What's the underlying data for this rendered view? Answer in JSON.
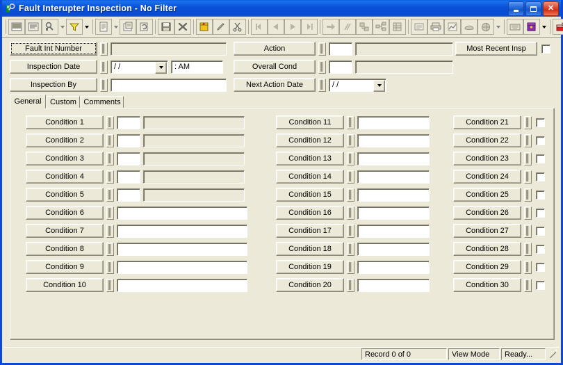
{
  "window": {
    "title": "Fault Interupter Inspection - No Filter",
    "app_icon": "magnifier-person-icon",
    "minimize_label": "Minimize",
    "maximize_label": "Maximize",
    "close_label": "Close"
  },
  "toolbar": {
    "buttons": [
      {
        "name": "select-records-icon",
        "glyph": "▦",
        "dropdown": false,
        "disabled": true
      },
      {
        "name": "query-builder-icon",
        "glyph": "◫",
        "dropdown": false,
        "disabled": true
      },
      {
        "name": "find-icon",
        "glyph": "⚲",
        "dropdown": true,
        "disabled": true
      },
      {
        "name": "filter-funnel-icon",
        "glyph": "▽",
        "dropdown": true,
        "disabled": false
      },
      {
        "name": "report-icon",
        "glyph": "▤",
        "dropdown": true,
        "disabled": true
      },
      {
        "name": "properties-icon",
        "glyph": "▣",
        "dropdown": false,
        "disabled": true
      },
      {
        "name": "refresh-icon",
        "glyph": "⧉",
        "dropdown": false,
        "disabled": true
      },
      {
        "name": "save-icon",
        "glyph": "▣",
        "dropdown": false,
        "disabled": false
      },
      {
        "name": "delete-icon",
        "glyph": "✕",
        "dropdown": false,
        "disabled": false
      },
      {
        "name": "new-record-icon",
        "glyph": "▤",
        "dropdown": false,
        "disabled": false
      },
      {
        "name": "edit-pencil-icon",
        "glyph": "✎",
        "dropdown": false,
        "disabled": false
      },
      {
        "name": "cut-scissors-icon",
        "glyph": "✂",
        "dropdown": false,
        "disabled": false
      },
      {
        "name": "first-record-icon",
        "glyph": "◀|",
        "dropdown": false,
        "disabled": true
      },
      {
        "name": "previous-record-icon",
        "glyph": "◀",
        "dropdown": false,
        "disabled": true
      },
      {
        "name": "next-record-icon",
        "glyph": "▶",
        "dropdown": false,
        "disabled": true
      },
      {
        "name": "last-record-icon",
        "glyph": "|▶",
        "dropdown": false,
        "disabled": true
      },
      {
        "name": "goto-record-icon",
        "glyph": "➡",
        "dropdown": false,
        "disabled": true
      },
      {
        "name": "clear-filter-icon",
        "glyph": "⫽",
        "dropdown": false,
        "disabled": true
      },
      {
        "name": "related-records-icon",
        "glyph": "⊞",
        "dropdown": false,
        "disabled": true
      },
      {
        "name": "hierarchy-icon",
        "glyph": "⧈",
        "dropdown": false,
        "disabled": true
      },
      {
        "name": "grid-view-icon",
        "glyph": "▦",
        "dropdown": false,
        "disabled": true
      },
      {
        "name": "list-view-icon",
        "glyph": "☰",
        "dropdown": false,
        "disabled": true
      },
      {
        "name": "print-icon",
        "glyph": "🖶",
        "dropdown": false,
        "disabled": true
      },
      {
        "name": "chart-icon",
        "glyph": "⛰",
        "dropdown": false,
        "disabled": true
      },
      {
        "name": "map-icon",
        "glyph": "◗",
        "dropdown": false,
        "disabled": true
      },
      {
        "name": "globe-icon",
        "glyph": "◯",
        "dropdown": true,
        "disabled": true
      },
      {
        "name": "keyboard-icon",
        "glyph": "⌨",
        "dropdown": false,
        "disabled": true
      },
      {
        "name": "books-icon",
        "glyph": "📚",
        "dropdown": true,
        "disabled": false
      },
      {
        "name": "export-icon",
        "glyph": "⇗",
        "dropdown": false,
        "disabled": false
      }
    ]
  },
  "header": {
    "fields": [
      {
        "label": "Fault Int Number",
        "value": "",
        "focused": true
      },
      {
        "label": "Inspection Date",
        "value": "/  /",
        "time_value": ":     AM"
      },
      {
        "label": "Inspection By",
        "value": ""
      },
      {
        "label": "Action",
        "code": "",
        "value": ""
      },
      {
        "label": "Overall Cond",
        "code": "",
        "value": ""
      },
      {
        "label": "Next Action Date",
        "value": "/  /"
      }
    ],
    "most_recent": {
      "label": "Most Recent Insp",
      "checked": false
    }
  },
  "tabs": [
    {
      "label": "General",
      "active": true
    },
    {
      "label": "Custom",
      "active": false
    },
    {
      "label": "Comments",
      "active": false
    }
  ],
  "conditions": {
    "column1": [
      {
        "label": "Condition 1",
        "code": "",
        "desc": "",
        "type": "code-desc"
      },
      {
        "label": "Condition 2",
        "code": "",
        "desc": "",
        "type": "code-desc"
      },
      {
        "label": "Condition 3",
        "code": "",
        "desc": "",
        "type": "code-desc"
      },
      {
        "label": "Condition 4",
        "code": "",
        "desc": "",
        "type": "code-desc"
      },
      {
        "label": "Condition 5",
        "code": "",
        "desc": "",
        "type": "code-desc"
      },
      {
        "label": "Condition 6",
        "value": "",
        "type": "wide"
      },
      {
        "label": "Condition 7",
        "value": "",
        "type": "wide"
      },
      {
        "label": "Condition 8",
        "value": "",
        "type": "wide"
      },
      {
        "label": "Condition 9",
        "value": "",
        "type": "wide"
      },
      {
        "label": "Condition 10",
        "value": "",
        "type": "wide"
      }
    ],
    "column2": [
      {
        "label": "Condition 11",
        "value": "",
        "type": "mid"
      },
      {
        "label": "Condition 12",
        "value": "",
        "type": "mid"
      },
      {
        "label": "Condition 13",
        "value": "",
        "type": "mid"
      },
      {
        "label": "Condition 14",
        "value": "",
        "type": "mid"
      },
      {
        "label": "Condition 15",
        "value": "",
        "type": "mid"
      },
      {
        "label": "Condition 16",
        "value": "",
        "type": "mid"
      },
      {
        "label": "Condition 17",
        "value": "",
        "type": "mid"
      },
      {
        "label": "Condition 18",
        "value": "",
        "type": "mid"
      },
      {
        "label": "Condition 19",
        "value": "",
        "type": "mid"
      },
      {
        "label": "Condition 20",
        "value": "",
        "type": "mid"
      }
    ],
    "column3": [
      {
        "label": "Condition 21",
        "checked": false,
        "type": "check"
      },
      {
        "label": "Condition 22",
        "checked": false,
        "type": "check"
      },
      {
        "label": "Condition 23",
        "checked": false,
        "type": "check"
      },
      {
        "label": "Condition 24",
        "checked": false,
        "type": "check"
      },
      {
        "label": "Condition 25",
        "checked": false,
        "type": "check"
      },
      {
        "label": "Condition 26",
        "checked": false,
        "type": "check"
      },
      {
        "label": "Condition 27",
        "checked": false,
        "type": "check"
      },
      {
        "label": "Condition 28",
        "checked": false,
        "type": "check"
      },
      {
        "label": "Condition 29",
        "checked": false,
        "type": "check"
      },
      {
        "label": "Condition 30",
        "checked": false,
        "type": "check"
      }
    ]
  },
  "statusbar": {
    "record": "Record 0 of 0",
    "mode": "View Mode",
    "state": "Ready..."
  },
  "colors": {
    "titlebar": "#0a4ad2",
    "face": "#ece9d8",
    "shadow": "#8c8878",
    "field": "#ffffff",
    "close": "#cd2f13"
  }
}
